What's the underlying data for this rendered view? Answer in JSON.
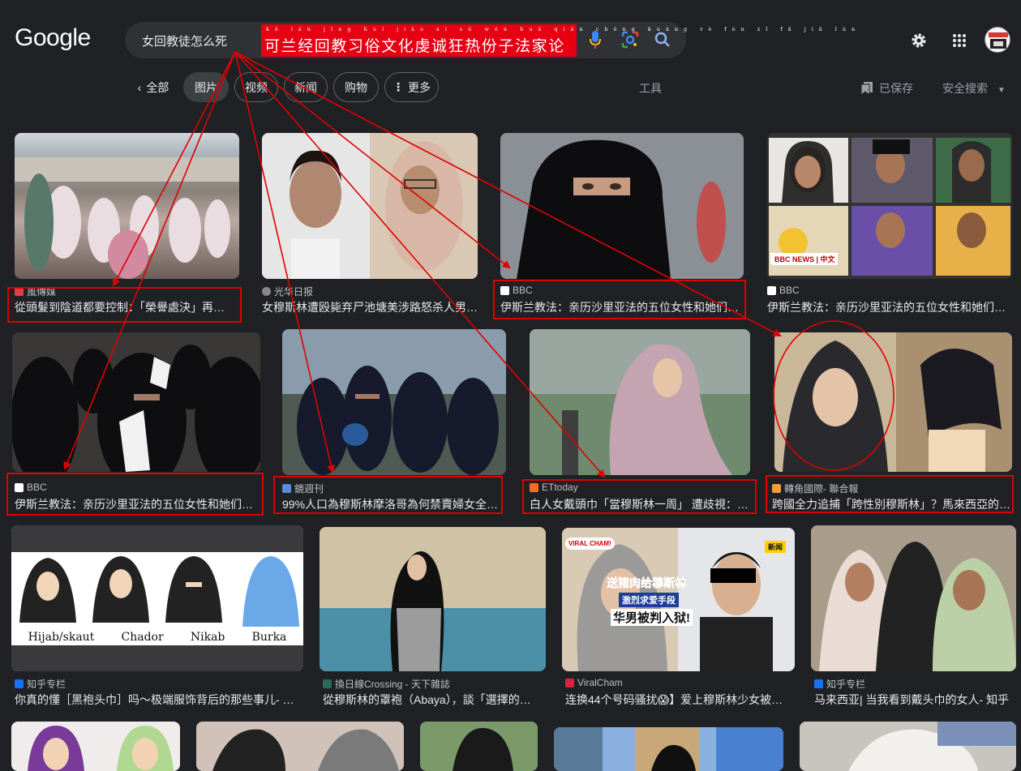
{
  "logo": "Google",
  "search": {
    "query": "女回教徒怎么死",
    "banner_pinyin": "kě lán jīng huí jiào xí sú wén huà qián chéng kuáng rè fèn zǐ fǎ jiā lùn",
    "banner_text": "可兰经回教习俗文化虔诚狂热份子法家论"
  },
  "tabs": {
    "all": "全部",
    "images": "图片",
    "video": "视频",
    "news": "新闻",
    "shopping": "购物",
    "more": "更多"
  },
  "tools": "工具",
  "saved": "已保存",
  "safesearch": "安全搜索",
  "colors": {
    "bg": "#202124",
    "annotation": "#e00000",
    "banner": "#e60012"
  },
  "results": [
    {
      "source": "風傳媒",
      "caption": "從頭髮到陰道都要控制：「榮譽處決」再…"
    },
    {
      "source": "光华日报",
      "caption": "女穆斯林遭殴毙弃尸池塘美涉路怒杀人男…"
    },
    {
      "source": "BBC",
      "caption": "伊斯兰教法：亲历沙里亚法的五位女性和她们…"
    },
    {
      "source": "BBC",
      "caption": "伊斯兰教法：亲历沙里亚法的五位女性和她们…",
      "image_text": "BBC NEWS | 中文"
    },
    {
      "source": "BBC",
      "caption": "伊斯兰教法：亲历沙里亚法的五位女性和她们…"
    },
    {
      "source": "鏡週刊",
      "caption": "99%人口為穆斯林摩洛哥為何禁賣婦女全…"
    },
    {
      "source": "ETtoday",
      "caption": "白人女戴頭巾「當穆斯林一周」 遭歧視：…"
    },
    {
      "source": "轉角國際- 聯合報",
      "caption": "跨國全力追捕「跨性別穆斯林」？馬來西亞的…"
    },
    {
      "source": "知乎专栏",
      "caption": "你真的懂［黑袍头巾］吗〜极端服饰背后的那些事儿- …",
      "image_labels": [
        "Hijab/skaut",
        "Chador",
        "Nikab",
        "Burka"
      ]
    },
    {
      "source": "換日線Crossing - 天下雜誌",
      "caption": "從穆斯林的罩袍（Abaya），談「選擇的…"
    },
    {
      "source": "ViralCham",
      "caption": "连换44个号码骚扰😱】爱上穆斯林少女被…",
      "image_text": [
        "送猪肉给穆斯林",
        "激烈求爱手段",
        "华男被判入狱!",
        "VIRAL CHAM!",
        "新闻"
      ]
    },
    {
      "source": "知乎专栏",
      "caption": "马来西亚| 当我看到戴头巾的女人- 知乎"
    }
  ]
}
